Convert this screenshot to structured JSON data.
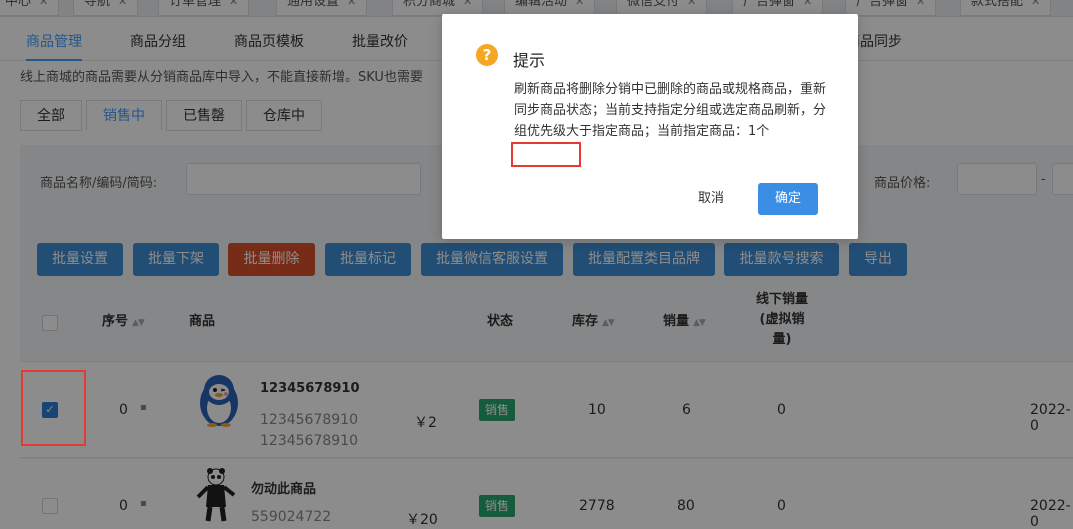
{
  "top_tabs": [
    {
      "label": "中心"
    },
    {
      "label": "导航"
    },
    {
      "label": "订单管理"
    },
    {
      "label": "通用设置"
    },
    {
      "label": "积分商城"
    },
    {
      "label": "编辑活动"
    },
    {
      "label": "微信支付"
    },
    {
      "label": "广告弹窗"
    },
    {
      "label": "广告弹窗"
    },
    {
      "label": "款式搭配"
    }
  ],
  "sub_tabs": [
    "商品管理",
    "商品分组",
    "商品页模板",
    "批量改价",
    "商品同步"
  ],
  "notice": "线上商城的商品需要从分销商品库中导入，不能直接新增。SKU也需要",
  "status_tabs": [
    "全部",
    "销售中",
    "已售罄",
    "仓库中"
  ],
  "filters": {
    "name_label": "商品名称/编码/简码:",
    "price_label": "商品价格:",
    "price_separator": "-"
  },
  "actions": [
    "批量设置",
    "批量下架",
    "批量删除",
    "批量标记",
    "批量微信客服设置",
    "批量配置类目品牌",
    "批量款号搜索",
    "导出"
  ],
  "table": {
    "headers": {
      "index": "序号",
      "product": "商品",
      "status": "状态",
      "stock": "库存",
      "sales": "销量",
      "offline_sales": "线下销量(虚拟销量)",
      "offline_line1": "线下销量",
      "offline_line2": "(虚拟销",
      "offline_line3": "量)"
    },
    "rows": [
      {
        "index": "0",
        "name": "12345678910",
        "code1": "12345678910",
        "code2": "12345678910",
        "price": "￥2",
        "status": "销售",
        "stock": "10",
        "sales": "6",
        "offline": "0",
        "date": "2022-0",
        "checked": true
      },
      {
        "index": "0",
        "name": "勿动此商品",
        "code1": "559024722",
        "code2": "",
        "price": "￥20",
        "status": "销售",
        "stock": "2778",
        "sales": "80",
        "offline": "0",
        "date": "2022-0",
        "checked": false
      }
    ]
  },
  "dialog": {
    "icon": "?",
    "title": "提示",
    "message": "刷新商品将删除分销中已删除的商品或规格商品，重新同步商品状态；当前支持指定分组或选定商品刷新，分组优先级大于指定商品；当前指定商品：1个",
    "cancel_label": "取消",
    "confirm_label": "确定"
  },
  "colors": {
    "primary": "#409eff",
    "danger": "#d9502a",
    "tag_green": "#2aa771",
    "warning": "#f5a623",
    "highlight": "#e53935"
  }
}
